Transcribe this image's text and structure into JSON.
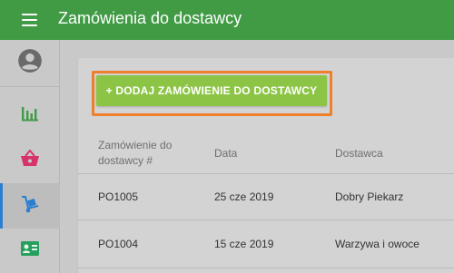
{
  "header": {
    "title": "Zamówienia do dostawcy",
    "menu_icon": "menu-icon"
  },
  "sidebar": {
    "items": [
      {
        "icon": "account-circle-icon",
        "color": "#6a6a6a"
      },
      {
        "icon": "bar-chart-icon",
        "color": "#3f9b48"
      },
      {
        "icon": "basket-icon",
        "color": "#d6336c"
      },
      {
        "icon": "hand-truck-icon",
        "color": "#2a7fd0",
        "active": true
      },
      {
        "icon": "contact-card-icon",
        "color": "#25a05e"
      }
    ]
  },
  "toolbar": {
    "add_label": "+ DODAJ ZAMÓWIENIE DO DOSTAWCY"
  },
  "table": {
    "columns": [
      "Zamówienie do dostawcy #",
      "Data",
      "Dostawca"
    ],
    "rows": [
      {
        "id": "PO1005",
        "date": "25 cze 2019",
        "supplier": "Dobry Piekarz"
      },
      {
        "id": "PO1004",
        "date": "15 cze 2019",
        "supplier": "Warzywa i owoce"
      }
    ]
  },
  "colors": {
    "header": "#419b45",
    "add_button": "#8cc445",
    "highlight": "#ef7f2a",
    "active_indicator": "#2a7fd0"
  }
}
